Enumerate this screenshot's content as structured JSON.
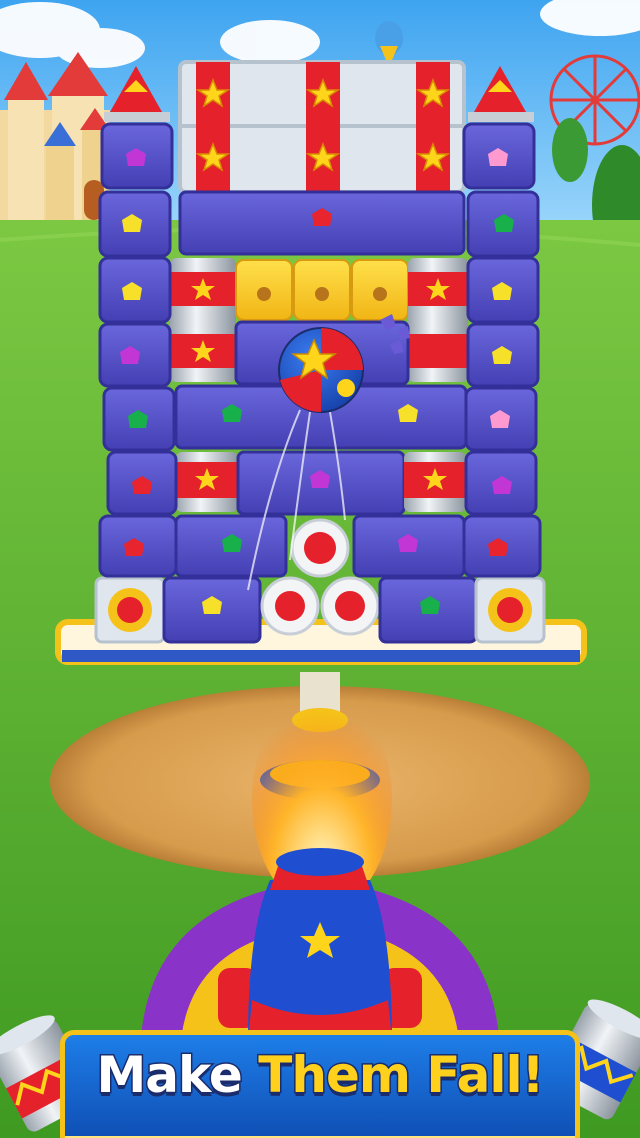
{
  "banner": {
    "headline_part1": "Make",
    "headline_part2": "Them Fall!"
  },
  "scene": {
    "tower": {
      "gem_colors": [
        "#e8242e",
        "#f7e02a",
        "#18b04a",
        "#c236d6",
        "#ff9ad0"
      ]
    },
    "palette": {
      "grass": "#5fb734",
      "sky": "#5bb6f5",
      "block": "#5550c8",
      "can_red": "#e5212b",
      "banner_blue": "#1765d1",
      "banner_gold": "#f5c21a"
    },
    "icons": [
      "star-ball-icon",
      "cannon-icon",
      "tin-can-icon",
      "gem-icon",
      "target-ring-icon",
      "honey-jar-icon"
    ]
  }
}
